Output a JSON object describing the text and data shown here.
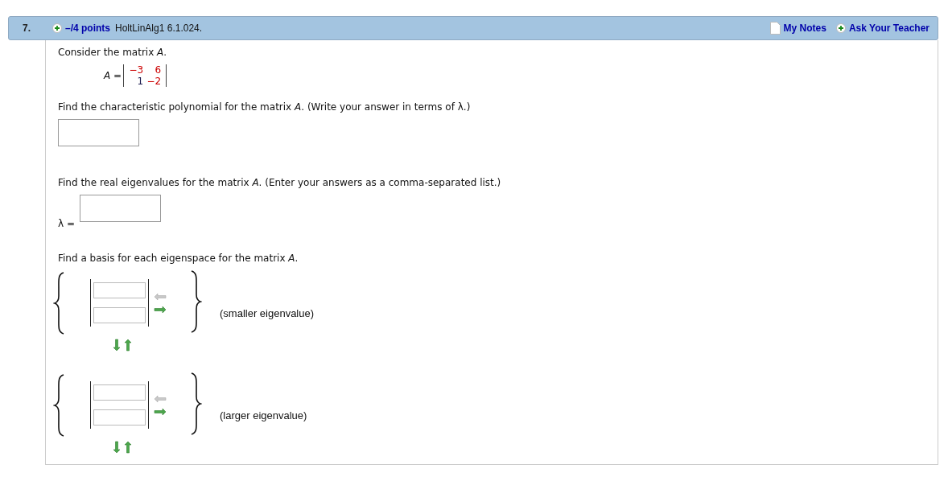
{
  "header": {
    "number": "7.",
    "points": "–/4 points",
    "source": "HoltLinAlg1 6.1.024.",
    "links": [
      {
        "kind": "notes",
        "label": "My Notes"
      },
      {
        "kind": "ask",
        "label": "Ask Your Teacher"
      }
    ]
  },
  "intro": "Consider the matrix *A*.",
  "matrix": {
    "label": "*A* =",
    "rows": [
      [
        {
          "value": "−3",
          "color": "#cc0000"
        },
        {
          "value": "6",
          "color": "#cc0000"
        }
      ],
      [
        {
          "value": "1",
          "color": "#1a1a4d"
        },
        {
          "value": "−2",
          "color": "#cc0000"
        }
      ]
    ]
  },
  "parts": [
    {
      "kind": "answer",
      "prompt": "Find the characteristic polynomial for the matrix *A*. (Write your answer in terms of λ.)"
    },
    {
      "kind": "answer",
      "prompt": "Find the real eigenvalues for the matrix *A*. (Enter your answers as a comma-separated list.)",
      "label": "λ ="
    },
    {
      "kind": "basis",
      "prompt": "Find a basis for each eigenspace for the matrix *A*.",
      "spaces": [
        {
          "caption": "(smaller eigenvalue)",
          "controls": [
            {
              "kind": "left",
              "disabled": true
            },
            {
              "kind": "right",
              "disabled": false
            },
            {
              "kind": "down",
              "disabled": false
            },
            {
              "kind": "up",
              "disabled": false
            }
          ]
        },
        {
          "caption": "(larger eigenvalue)",
          "controls": [
            {
              "kind": "left",
              "disabled": true
            },
            {
              "kind": "right",
              "disabled": false
            },
            {
              "kind": "down",
              "disabled": false
            },
            {
              "kind": "up",
              "disabled": false
            }
          ]
        }
      ]
    }
  ]
}
